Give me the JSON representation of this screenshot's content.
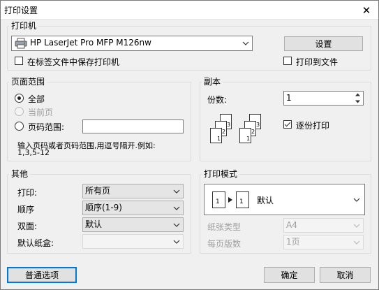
{
  "window": {
    "title": "打印设置",
    "close_glyph": "✕"
  },
  "printer": {
    "group_label": "打印机",
    "selected_printer": "HP LaserJet Pro MFP M126nw",
    "save_in_tab_label": "在标签文件中保存打印机",
    "settings_button": "设置",
    "print_to_file_label": "打印到文件"
  },
  "page_range": {
    "group_label": "页面范围",
    "all_label": "全部",
    "current_page_label": "当前页",
    "page_range_label": "页码范围:",
    "page_range_value": "",
    "hint_line1": "输入页码或者页码范围,用逗号隔开.例如:",
    "hint_line2": "1,3,5-12"
  },
  "copies": {
    "group_label": "副本",
    "count_label": "份数:",
    "count_value": "1",
    "collate_label": "逐份打印",
    "collate_checked": true
  },
  "other": {
    "group_label": "其他",
    "rows": [
      {
        "label": "打印:",
        "value": "所有页",
        "disabled": false
      },
      {
        "label": "顺序",
        "value": "顺序(1-9)",
        "disabled": false
      },
      {
        "label": "双面:",
        "value": "默认",
        "disabled": false
      },
      {
        "label": "默认纸盒:",
        "value": "",
        "disabled": true
      }
    ]
  },
  "print_mode": {
    "group_label": "打印模式",
    "mode_value": "默认",
    "mode_page_a": "1",
    "mode_page_b": "1",
    "paper_type_label": "纸张类型",
    "paper_type_value": "A4",
    "pages_per_sheet_label": "每页版数",
    "pages_per_sheet_value": "1页"
  },
  "footer": {
    "general_options_button": "普通选项",
    "ok_button": "确定",
    "cancel_button": "取消"
  },
  "colors": {
    "dialog_bg": "#f0f0f0",
    "focus_border": "#0078d7",
    "disabled_text": "#a0a0a0"
  }
}
